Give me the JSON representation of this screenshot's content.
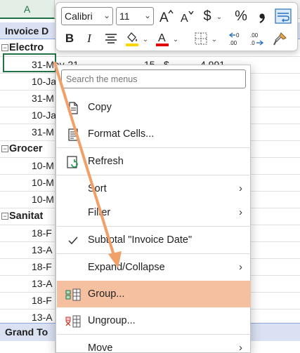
{
  "sheet": {
    "column_header": "A",
    "header_row": "Invoice D",
    "grand_total": "Grand To",
    "active_cell_value": "31-May-21",
    "active_row_qty": "15",
    "active_row_currency": "$",
    "active_row_amount": "4,991",
    "groups": [
      {
        "label": "Electro",
        "dates": [
          "31-May-21",
          "10-Ja",
          "31-M",
          "10-Ja",
          "31-M"
        ]
      },
      {
        "label": "Grocer",
        "dates": [
          "10-M",
          "10-M",
          "10-M"
        ]
      },
      {
        "label": "Sanitat",
        "dates": [
          "18-F",
          "13-A",
          "18-F",
          "13-A",
          "18-F",
          "13-A"
        ]
      }
    ]
  },
  "mini_toolbar": {
    "font_name": "Calibri",
    "font_size": "11",
    "buttons": {
      "increase_font": "A^",
      "decrease_font": "A˅",
      "currency": "$",
      "percent": "%",
      "comma": "❟",
      "bold": "B",
      "italic": "I",
      "font_color": "A"
    },
    "colors": {
      "fill_color": "#ffd700",
      "font_color": "#e00000"
    }
  },
  "context_menu": {
    "search_placeholder": "Search the menus",
    "items": [
      {
        "label": "Copy",
        "icon": "copy-icon"
      },
      {
        "label": "Format Cells...",
        "icon": "format-cells-icon"
      },
      {
        "label": "Refresh",
        "icon": "refresh-icon"
      },
      {
        "label": "Sort",
        "submenu": true
      },
      {
        "label": "Filter",
        "submenu": true
      },
      {
        "label": "Subtotal \"Invoice Date\"",
        "icon": "checkmark-icon"
      },
      {
        "label": "Expand/Collapse",
        "submenu": true
      },
      {
        "label": "Group...",
        "icon": "group-icon",
        "highlighted": true
      },
      {
        "label": "Ungroup...",
        "icon": "ungroup-icon"
      },
      {
        "label": "Move",
        "submenu": true
      }
    ],
    "highlight_color": "#f4c09f"
  },
  "annotation": {
    "arrow_color": "#f2a06a"
  }
}
